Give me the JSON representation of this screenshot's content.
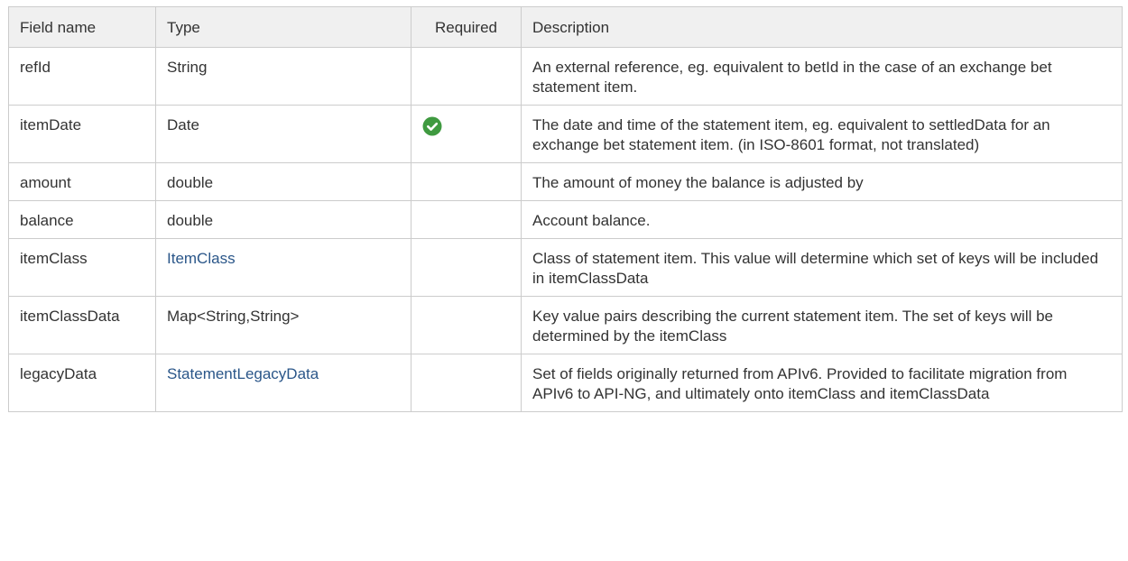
{
  "table": {
    "headers": {
      "field_name": "Field name",
      "type": "Type",
      "required": "Required",
      "description": "Description"
    },
    "rows": [
      {
        "field": "refId",
        "type": "String",
        "type_is_link": false,
        "required": false,
        "description": "An external reference, eg. equivalent to betId in the case of an exchange bet statement item."
      },
      {
        "field": "itemDate",
        "type": "Date",
        "type_is_link": false,
        "required": true,
        "description": "The date and time of the statement item, eg. equivalent to settledData for an exchange bet statement item. (in ISO-8601 format, not translated)"
      },
      {
        "field": "amount",
        "type": "double",
        "type_is_link": false,
        "required": false,
        "description": "The amount of money the balance is adjusted by"
      },
      {
        "field": "balance",
        "type": "double",
        "type_is_link": false,
        "required": false,
        "description": "Account balance."
      },
      {
        "field": "itemClass",
        "type": "ItemClass",
        "type_is_link": true,
        "required": false,
        "description": "Class of statement item. This value will determine which set of keys will be included in itemClassData"
      },
      {
        "field": "itemClassData",
        "type": "Map<String,String>",
        "type_is_link": false,
        "required": false,
        "description": "Key value pairs describing the current statement item. The set of keys will be determined by the itemClass"
      },
      {
        "field": "legacyData",
        "type": "StatementLegacyData",
        "type_is_link": true,
        "required": false,
        "description": "Set of fields originally returned from APIv6. Provided to facilitate migration from APIv6 to API-NG, and ultimately onto itemClass and itemClassData"
      }
    ]
  },
  "colors": {
    "header_bg": "#f0f0f0",
    "border": "#cccccc",
    "text": "#333333",
    "link": "#2a5689",
    "check_green": "#3f9a40"
  },
  "icons": {
    "required": "check-circle-icon"
  }
}
